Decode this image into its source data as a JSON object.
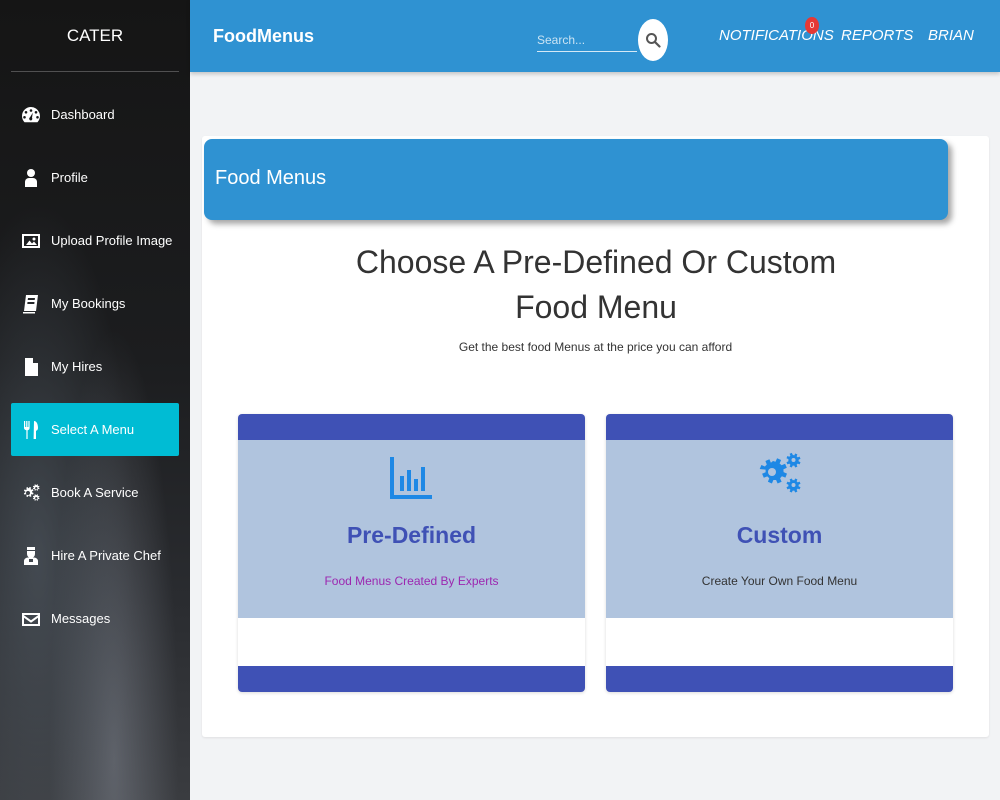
{
  "sidebar": {
    "brand": "CATER",
    "items": [
      {
        "label": "Dashboard",
        "icon": "dashboard-icon"
      },
      {
        "label": "Profile",
        "icon": "person-icon"
      },
      {
        "label": "Upload Profile Image",
        "icon": "image-icon"
      },
      {
        "label": "My Bookings",
        "icon": "book-icon"
      },
      {
        "label": "My Hires",
        "icon": "document-icon"
      },
      {
        "label": "Select A Menu",
        "icon": "fork-knife-icon",
        "active": true
      },
      {
        "label": "Book A Service",
        "icon": "gears-icon"
      },
      {
        "label": "Hire A Private Chef",
        "icon": "chef-icon"
      },
      {
        "label": "Messages",
        "icon": "envelope-icon"
      }
    ]
  },
  "topbar": {
    "title": "FoodMenus",
    "search_placeholder": "Search...",
    "notifications_label": "NOTIFICATIONS",
    "notifications_count": "0",
    "reports_label": "REPORTS",
    "user_label": "BRIAN"
  },
  "main": {
    "header_title": "Food Menus",
    "heading": "Choose A Pre-Defined Or Custom Food Menu",
    "subheading": "Get the best food Menus at the price you can afford",
    "options": [
      {
        "title": "Pre-Defined",
        "description": "Food Menus Created By Experts",
        "icon": "bar-chart-icon",
        "description_color": "#9c27b0"
      },
      {
        "title": "Custom",
        "description": "Create Your Own Food Menu",
        "icon": "gears-icon",
        "description_color": "#333333"
      }
    ]
  },
  "colors": {
    "primary_blue": "#2f92d2",
    "indigo": "#3f51b5",
    "active_cyan": "#00bcd4",
    "option_bg": "#b0c4de",
    "badge_red": "#e53935"
  }
}
